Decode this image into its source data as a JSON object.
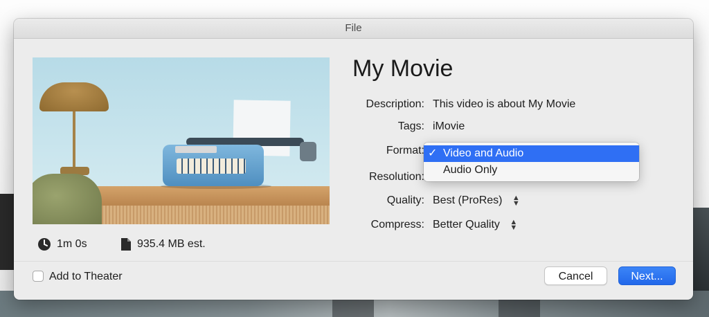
{
  "window": {
    "title": "File"
  },
  "movie": {
    "title": "My Movie",
    "duration": "1m 0s",
    "size": "935.4 MB est."
  },
  "form": {
    "description": {
      "label": "Description:",
      "value": "This video is about My Movie"
    },
    "tags": {
      "label": "Tags:",
      "value": "iMovie"
    },
    "format": {
      "label": "Format:",
      "value": "Video and Audio"
    },
    "resolution": {
      "label": "Resolution:"
    },
    "quality": {
      "label": "Quality:",
      "value": "Best (ProRes)"
    },
    "compress": {
      "label": "Compress:",
      "value": "Better Quality"
    }
  },
  "format_menu": {
    "check": "✓",
    "options": [
      {
        "label": "Video and Audio",
        "selected": true
      },
      {
        "label": "Audio Only",
        "selected": false
      }
    ]
  },
  "footer": {
    "add_to_theater_label": "Add to Theater",
    "add_to_theater_checked": false,
    "cancel_label": "Cancel",
    "next_label": "Next..."
  },
  "icons": {
    "duration": "clock-icon",
    "size": "document-icon",
    "stepper": "up-down-chevron-icon"
  },
  "colors": {
    "accent": "#2f6ff4",
    "dialog_bg": "#ececec"
  }
}
